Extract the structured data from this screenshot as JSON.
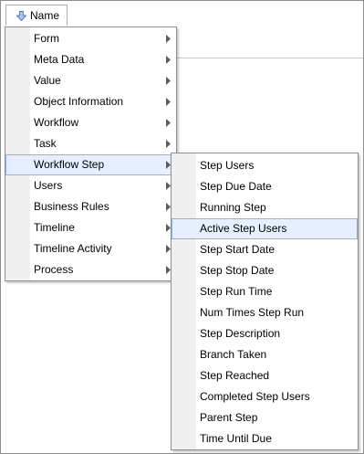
{
  "header": {
    "column_label": "Name",
    "sort_icon": "arrow-down-icon"
  },
  "menu": {
    "items": [
      {
        "label": "Form",
        "submenu": true
      },
      {
        "label": "Meta Data",
        "submenu": true
      },
      {
        "label": "Value",
        "submenu": true
      },
      {
        "label": "Object Information",
        "submenu": true
      },
      {
        "label": "Workflow",
        "submenu": true
      },
      {
        "label": "Task",
        "submenu": true
      },
      {
        "label": "Workflow Step",
        "submenu": true,
        "highlighted": true
      },
      {
        "label": "Users",
        "submenu": true
      },
      {
        "label": "Business Rules",
        "submenu": true
      },
      {
        "label": "Timeline",
        "submenu": true
      },
      {
        "label": "Timeline Activity",
        "submenu": true
      },
      {
        "label": "Process",
        "submenu": true
      }
    ]
  },
  "submenu": {
    "items": [
      {
        "label": "Step Users"
      },
      {
        "label": "Step Due Date"
      },
      {
        "label": "Running Step"
      },
      {
        "label": "Active Step Users",
        "highlighted": true
      },
      {
        "label": "Step Start Date"
      },
      {
        "label": "Step Stop Date"
      },
      {
        "label": "Step Run Time"
      },
      {
        "label": "Num Times Step Run"
      },
      {
        "label": "Step Description"
      },
      {
        "label": "Branch Taken"
      },
      {
        "label": "Step Reached"
      },
      {
        "label": "Completed Step Users"
      },
      {
        "label": "Parent Step"
      },
      {
        "label": "Time Until Due"
      }
    ]
  },
  "colors": {
    "highlight_bg": "#e5efff",
    "highlight_border": "#8fb1e6",
    "arrow_blue": "#4a7fd0",
    "gutter": "#f0f0f0"
  }
}
